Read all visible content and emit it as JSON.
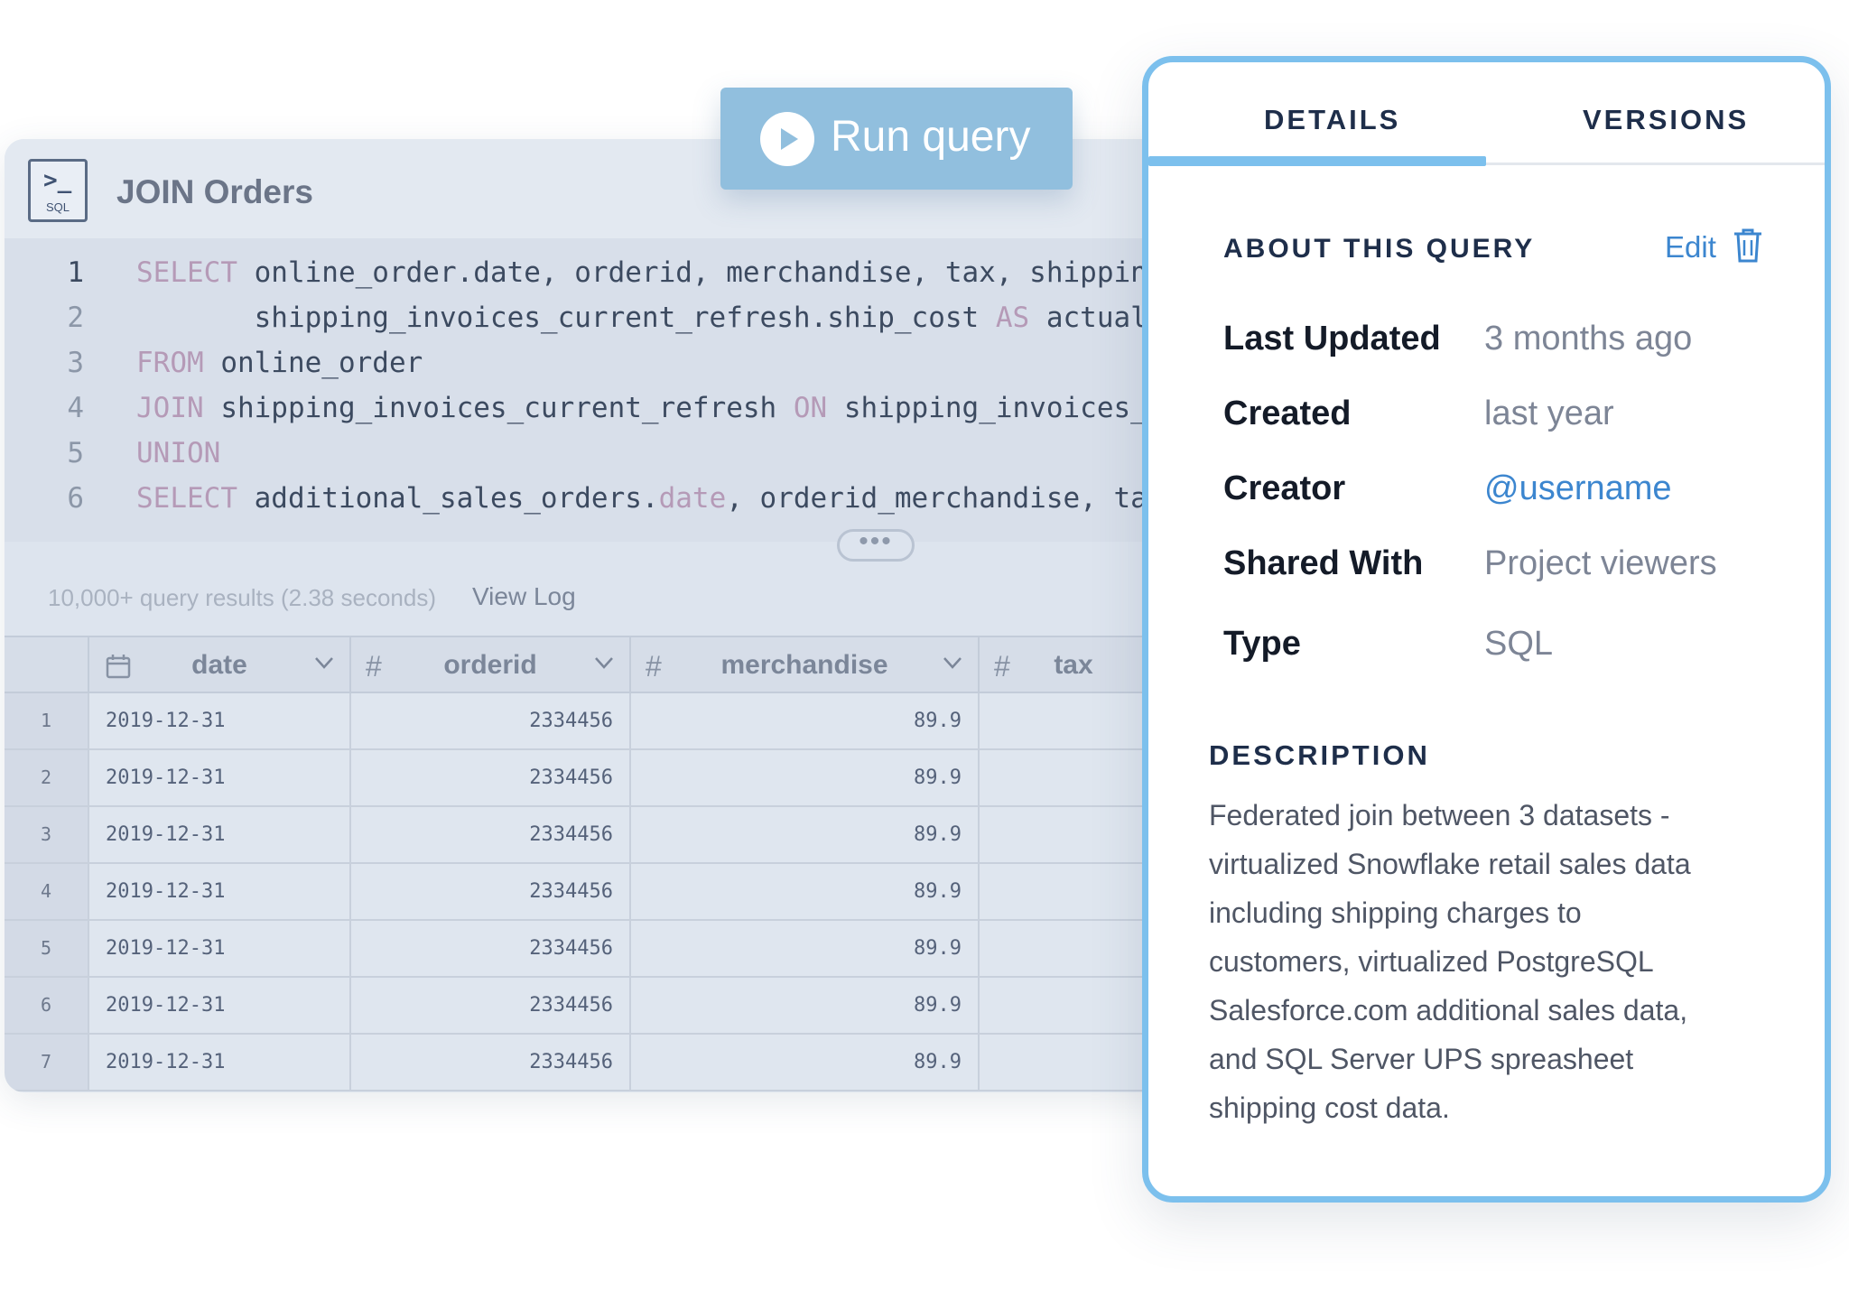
{
  "editor": {
    "icon_label": "SQL",
    "icon_prompt": ">_",
    "title": "JOIN Orders",
    "code_lines": [
      {
        "num": "1",
        "parts": [
          {
            "t": "SELECT",
            "kw": true
          },
          {
            "t": " online_order.date, orderid, merchandise, tax, shippin"
          }
        ]
      },
      {
        "num": "2",
        "parts": [
          {
            "t": "       shipping_invoices_current_refresh.ship_cost "
          },
          {
            "t": "AS",
            "kw": true
          },
          {
            "t": " actual"
          }
        ]
      },
      {
        "num": "3",
        "parts": [
          {
            "t": "FROM",
            "kw": true
          },
          {
            "t": " online_order"
          }
        ]
      },
      {
        "num": "4",
        "parts": [
          {
            "t": "JOIN",
            "kw": true
          },
          {
            "t": " shipping_invoices_current_refresh "
          },
          {
            "t": "ON",
            "kw": true
          },
          {
            "t": " shipping_invoices_"
          }
        ]
      },
      {
        "num": "5",
        "parts": [
          {
            "t": "UNION",
            "kw": true
          }
        ]
      },
      {
        "num": "6",
        "parts": [
          {
            "t": "SELECT",
            "kw": true
          },
          {
            "t": " additional_sales_orders."
          },
          {
            "t": "date",
            "kw": true
          },
          {
            "t": ", orderid_merchandise, ta"
          }
        ]
      }
    ],
    "drag_handle": "•••",
    "results_count": "10,000+ query results (2.38 seconds)",
    "view_log": "View Log"
  },
  "table": {
    "columns": [
      {
        "name": "date",
        "icon": "calendar-icon"
      },
      {
        "name": "orderid",
        "icon": "hash"
      },
      {
        "name": "merchandise",
        "icon": "hash"
      },
      {
        "name": "tax",
        "icon": "hash"
      }
    ],
    "hash_symbol": "#",
    "rows": [
      {
        "n": "1",
        "date": "2019-12-31",
        "orderid": "2334456",
        "merchandise": "89.9"
      },
      {
        "n": "2",
        "date": "2019-12-31",
        "orderid": "2334456",
        "merchandise": "89.9"
      },
      {
        "n": "3",
        "date": "2019-12-31",
        "orderid": "2334456",
        "merchandise": "89.9"
      },
      {
        "n": "4",
        "date": "2019-12-31",
        "orderid": "2334456",
        "merchandise": "89.9"
      },
      {
        "n": "5",
        "date": "2019-12-31",
        "orderid": "2334456",
        "merchandise": "89.9"
      },
      {
        "n": "6",
        "date": "2019-12-31",
        "orderid": "2334456",
        "merchandise": "89.9"
      },
      {
        "n": "7",
        "date": "2019-12-31",
        "orderid": "2334456",
        "merchandise": "89.9"
      }
    ]
  },
  "run_button": {
    "label": "Run query",
    "icon": "play-icon"
  },
  "details": {
    "tabs": [
      {
        "label": "DETAILS",
        "active": true
      },
      {
        "label": "VERSIONS",
        "active": false
      }
    ],
    "about_heading": "ABOUT THIS QUERY",
    "edit_label": "Edit",
    "properties": [
      {
        "key": "Last Updated",
        "value": "3 months ago"
      },
      {
        "key": "Created",
        "value": "last year"
      },
      {
        "key": "Creator",
        "value": "@username"
      },
      {
        "key": "Shared With",
        "value": "Project viewers"
      },
      {
        "key": "Type",
        "value": "SQL"
      }
    ],
    "description_heading": "DESCRIPTION",
    "description_lines": [
      "Federated join between 3 datasets -",
      "virtualized Snowflake retail sales data",
      "including shipping charges to",
      "customers, virtualized PostgreSQL",
      "Salesforce.com additional sales data,",
      "and SQL Server UPS spreasheet",
      "shipping cost data."
    ]
  },
  "colors": {
    "accent": "#7cc0ed",
    "run_button": "#91bfde",
    "link": "#3c86cf",
    "keyword": "#b59ab7"
  }
}
